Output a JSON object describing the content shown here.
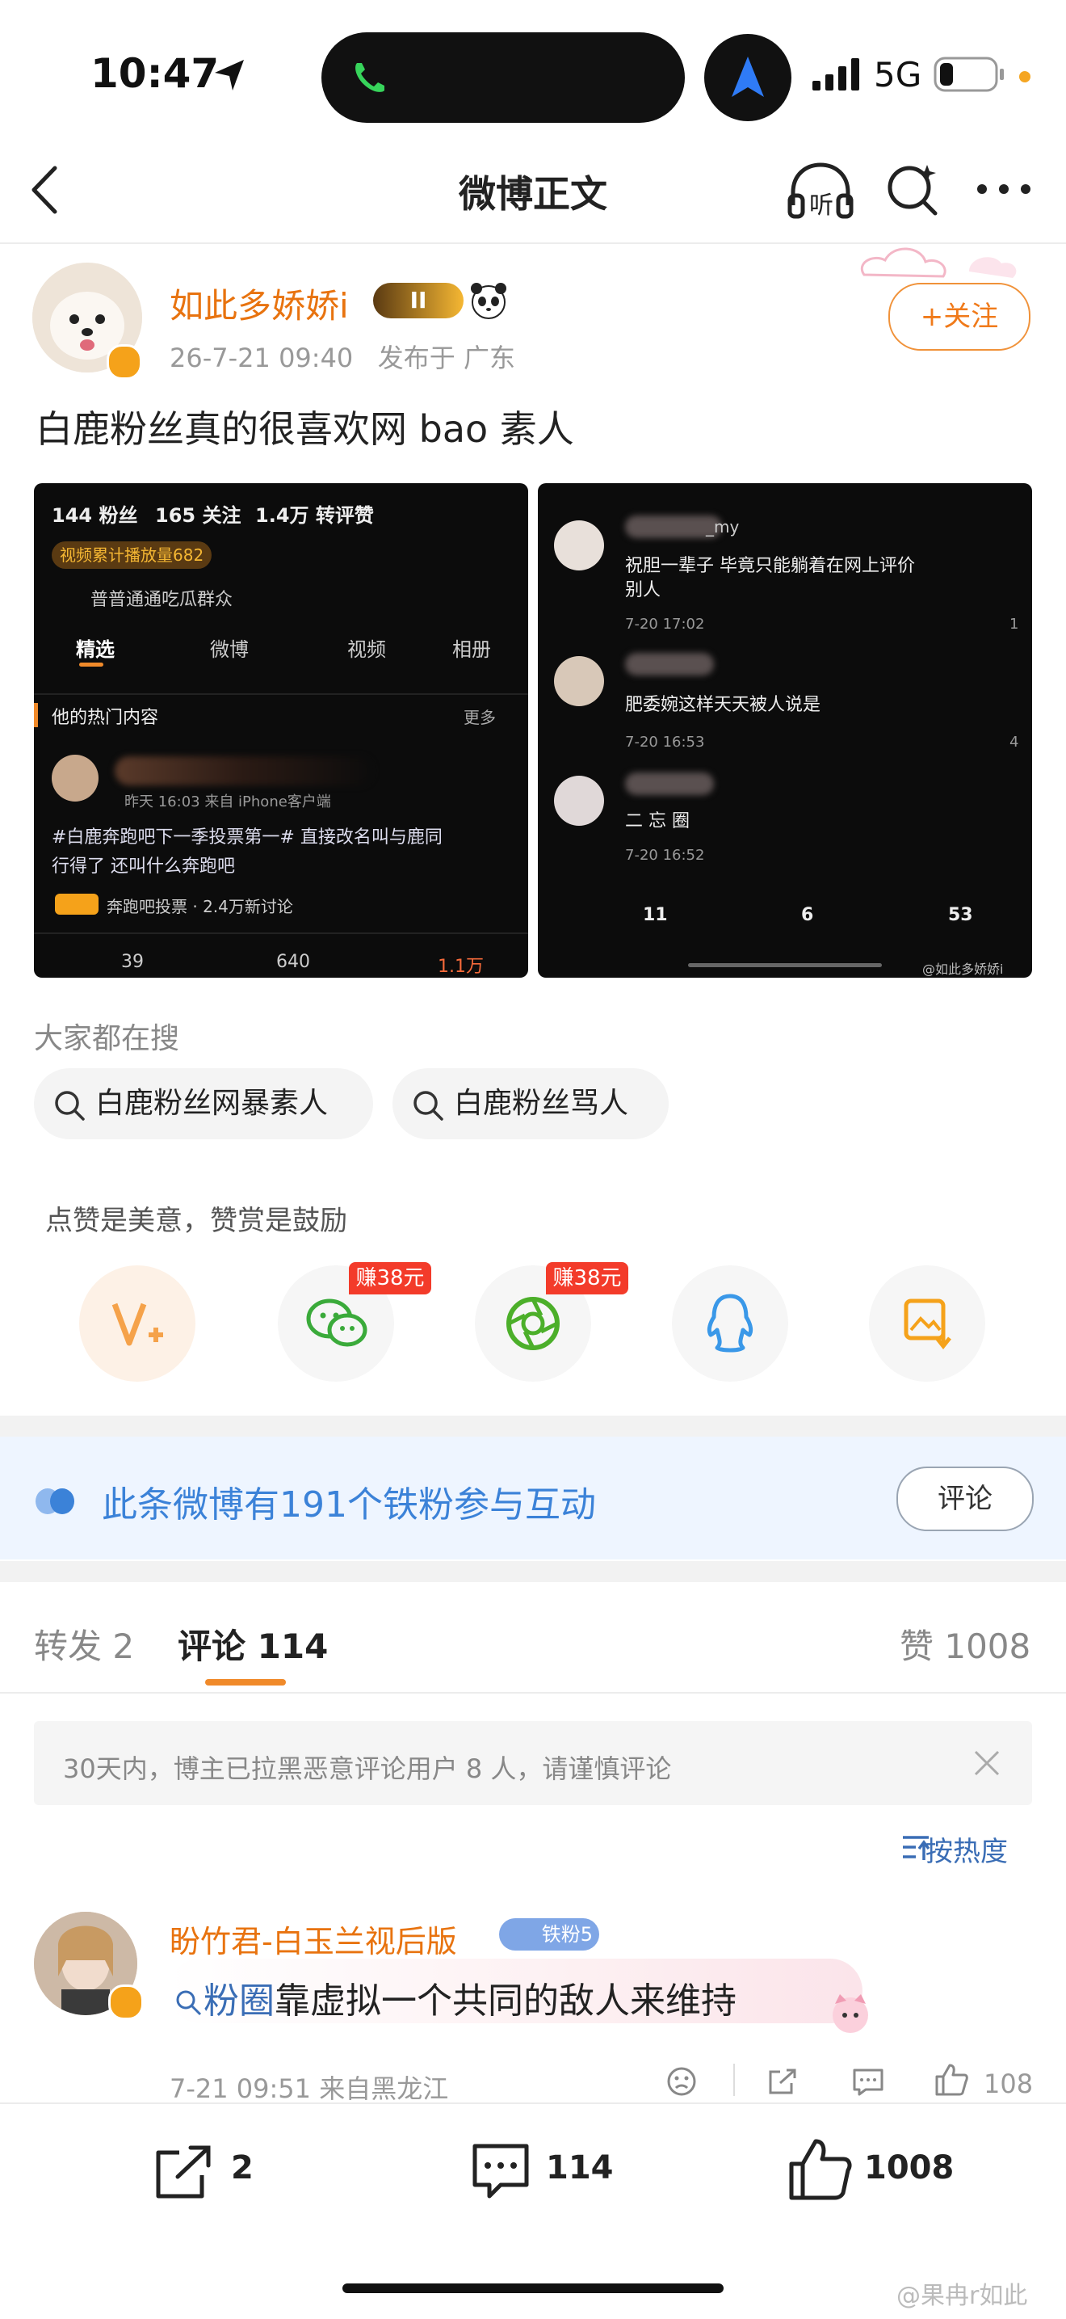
{
  "status_bar": {
    "time": "10:47",
    "network": "5G"
  },
  "header": {
    "title": "微博正文"
  },
  "post": {
    "author": "如此多娇娇i",
    "badge": "II",
    "timestamp": "26-7-21 09:40",
    "location": "发布于 广东",
    "follow_label": "+关注",
    "text": "白鹿粉丝真的很喜欢网 bao 素人"
  },
  "screenshot1": {
    "stats": [
      "144 粉丝",
      "165 关注",
      "1.4万 转评赞"
    ],
    "play_badge": "视频累计播放量682",
    "group": "普普通通吃瓜群众",
    "tabs": [
      "精选",
      "微博",
      "视频",
      "相册"
    ],
    "hot_title": "他的热门内容",
    "hot_more": "更多",
    "post_meta": "昨天 16:03  来自 iPhone客户端",
    "post_line1": "#白鹿奔跑吧下一季投票第一# 直接改名叫与鹿同",
    "post_line2": "行得了 还叫什么奔跑吧",
    "topic": "奔跑吧投票 · 2.4万新讨论",
    "counts": [
      "39",
      "640",
      "1.1万"
    ]
  },
  "screenshot2": {
    "c1_user": "_my",
    "c1_text1": "祝胆一辈子 毕竟只能躺着在网上评价",
    "c1_text2": "别人",
    "c1_time": "7-20 17:02",
    "c1_likes": "1",
    "c2_text": "肥委婉这样天天被人说是",
    "c2_time": "7-20 16:53",
    "c2_likes": "4",
    "c3_text": "二 忘 圈",
    "c3_time": "7-20 16:52",
    "bar_counts": [
      "11",
      "6",
      "53"
    ],
    "watermark": "@如此多娇娇i"
  },
  "search": {
    "title": "大家都在搜",
    "chips": [
      "白鹿粉丝网暴素人",
      "白鹿粉丝骂人"
    ]
  },
  "reward": {
    "tip": "点赞是美意，赞赏是鼓励",
    "earn_badge": "赚38元"
  },
  "fans": {
    "text": "此条微博有191个铁粉参与互动",
    "button": "评论"
  },
  "tabs": {
    "repost": "转发 2",
    "comment": "评论 114",
    "like": "赞 1008"
  },
  "notice": {
    "text": "30天内，博主已拉黑恶意评论用户 8 人，请谨慎评论"
  },
  "sort": {
    "label": "按热度"
  },
  "comment": {
    "name": "盼竹君-白玉兰视后版",
    "fan_badge": "铁粉5",
    "link_text": "粉圈",
    "text": "靠虚拟一个共同的敌人来维持",
    "meta": "7-21 09:51  来自黑龙江",
    "likes": "108"
  },
  "bottom": {
    "reposts": "2",
    "comments": "114",
    "likes": "1008"
  },
  "watermark": "@果冉r如此",
  "colors": {
    "accent_orange": "#f07a1a",
    "link_blue": "#3a6db5",
    "fans_blue": "#3b82d8"
  }
}
